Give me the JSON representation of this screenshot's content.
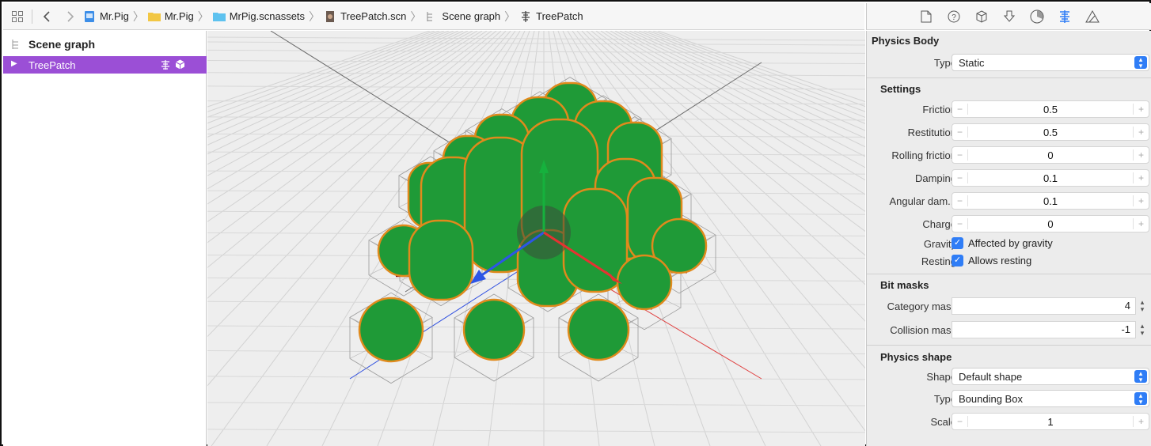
{
  "toolbar": {
    "crumbs": [
      "Mr.Pig",
      "Mr.Pig",
      "MrPig.scnassets",
      "TreePatch.scn",
      "Scene graph",
      "TreePatch"
    ]
  },
  "outline": {
    "root_label": "Scene graph",
    "selected_label": "TreePatch",
    "selection_color": "#9b4fd6"
  },
  "inspector": {
    "tab_icons": [
      "file-icon",
      "help-icon",
      "cube-icon",
      "node-icon",
      "material-icon",
      "physics-icon",
      "attributes-icon"
    ],
    "physics_body": {
      "title": "Physics Body",
      "type_label": "Type",
      "type_value": "Static"
    },
    "settings": {
      "title": "Settings",
      "friction": {
        "label": "Friction",
        "value": "0.5"
      },
      "restitution": {
        "label": "Restitution",
        "value": "0.5"
      },
      "rolling_friction": {
        "label": "Rolling friction",
        "value": "0"
      },
      "damping": {
        "label": "Damping",
        "value": "0.1"
      },
      "angular_damping": {
        "label": "Angular dam...",
        "value": "0.1"
      },
      "charge": {
        "label": "Charge",
        "value": "0"
      },
      "gravity": {
        "label": "Gravity",
        "checkbox": "Affected by gravity",
        "checked": true
      },
      "resting": {
        "label": "Resting",
        "checkbox": "Allows resting",
        "checked": true
      }
    },
    "bit_masks": {
      "title": "Bit masks",
      "category": {
        "label": "Category mask",
        "value": "4"
      },
      "collision": {
        "label": "Collision mask",
        "value": "-1"
      }
    },
    "physics_shape": {
      "title": "Physics shape",
      "shape_label": "Shape",
      "shape_value": "Default shape",
      "type_label": "Type",
      "type_value": "Bounding Box",
      "scale_label": "Scale",
      "scale_value": "1"
    },
    "accent_color": "#2f7df6"
  },
  "viewport": {
    "tree_color": "#1f9a37",
    "outline_color": "#e08a1c",
    "trunk_color": "#8a1212"
  }
}
